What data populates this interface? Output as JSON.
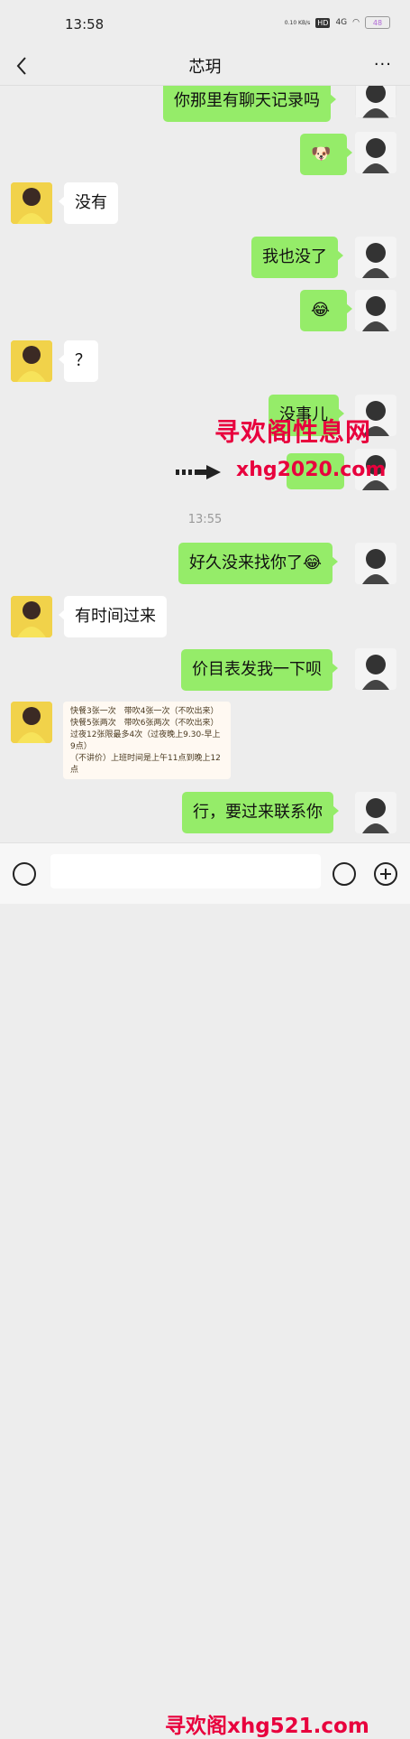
{
  "status_bar": {
    "time": "13:58",
    "net_speed": "0.10\nKB/s",
    "hd": "HD",
    "signal": "4G",
    "battery": "48"
  },
  "header": {
    "title": "芯玥",
    "more": "···"
  },
  "messages": [
    {
      "side": "right",
      "text": "你那里有聊天记录吗"
    },
    {
      "side": "right",
      "text": "🐶"
    },
    {
      "side": "left",
      "text": "没有"
    },
    {
      "side": "right",
      "text": "我也没了"
    },
    {
      "side": "right",
      "text": "😂"
    },
    {
      "side": "left",
      "text": "？"
    },
    {
      "side": "right",
      "text": "没事儿"
    },
    {
      "side": "right",
      "text": "好久没来找你了😂"
    },
    {
      "side": "left",
      "text": "有时间过来"
    },
    {
      "side": "right",
      "text": "价目表发我一下呗"
    },
    {
      "side": "right",
      "text": "行，要过来联系你"
    }
  ],
  "timestamp": "13:55",
  "price_card": "快餐3张一次　带吹4张一次（不吹出来）\n快餐5张两次　带吹6张两次（不吹出来）\n过夜12张限最多4次（过夜晚上9.30-早上9点）\n（不讲价）上班时间是上午11点到晚上12点",
  "watermarks": {
    "top": "寻欢阁性息网",
    "middle": "xhg2020.com",
    "bottom": "寻欢阁xhg521.com"
  },
  "icons": {
    "back": "chevron-left-icon",
    "more": "more-dots-icon",
    "voice": "voice-icon",
    "emoji": "emoji-icon",
    "plus": "plus-icon"
  }
}
